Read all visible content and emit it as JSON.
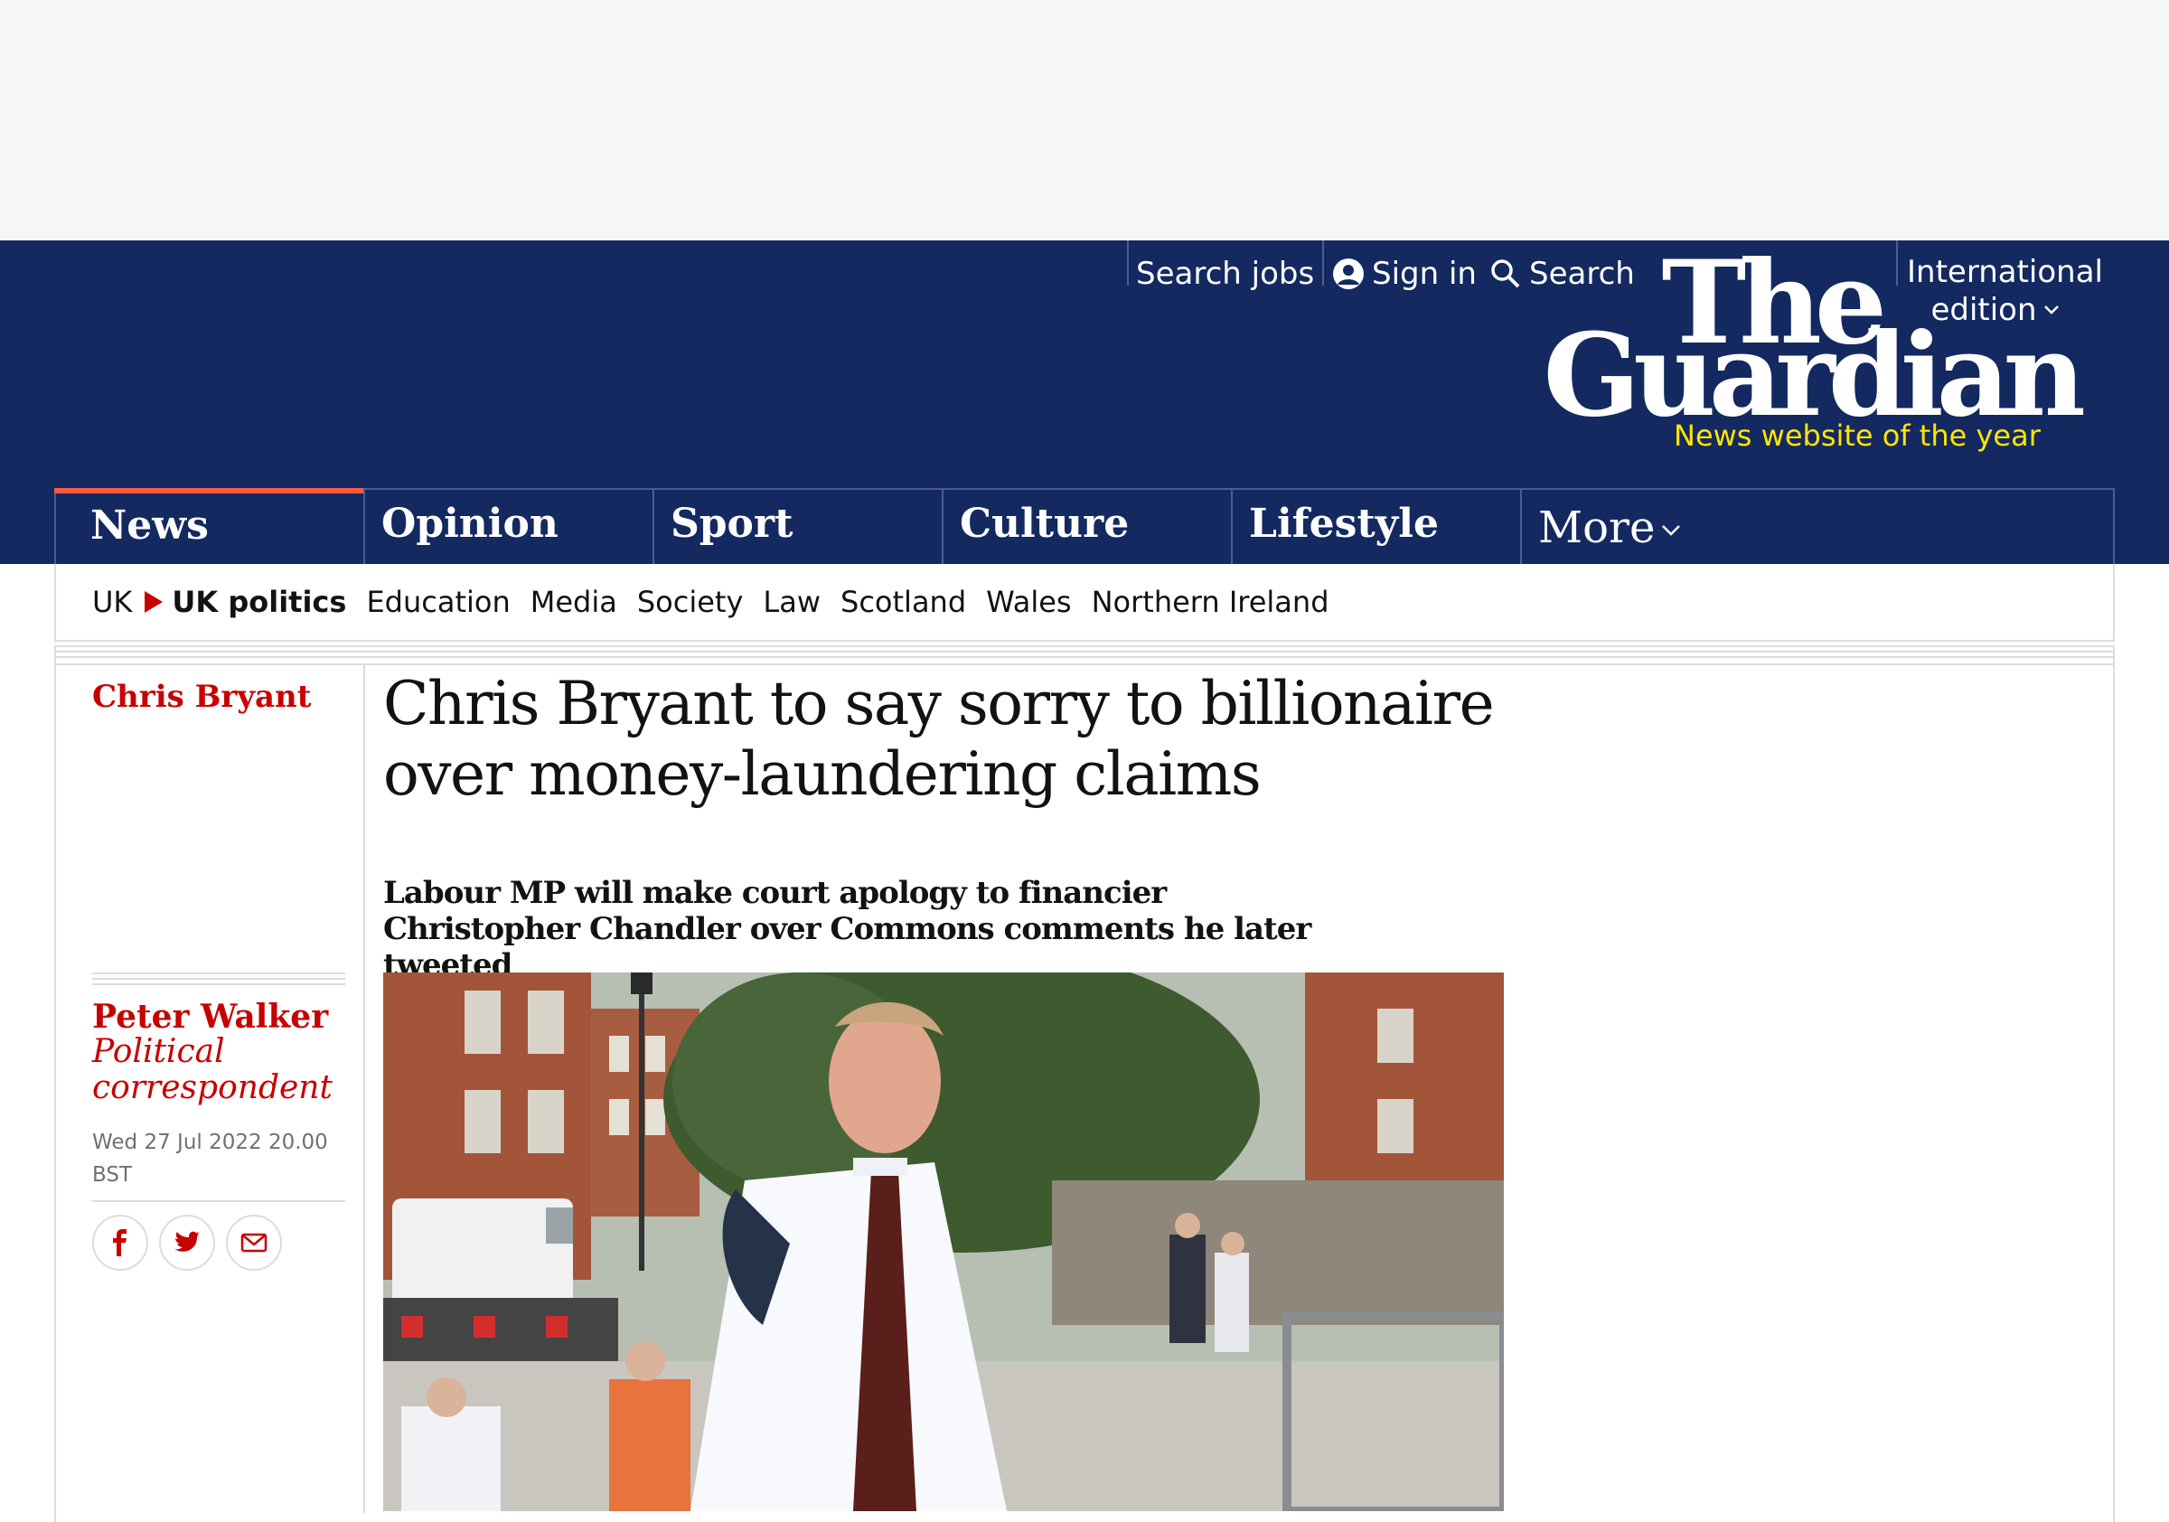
{
  "topbar": {
    "search_jobs": "Search jobs",
    "sign_in": "Sign in",
    "search": "Search",
    "edition_line1": "International",
    "edition_line2": "edition"
  },
  "logo": {
    "line1": "The",
    "line2": "Guardian",
    "tagline": "News website of the year"
  },
  "pillars": [
    {
      "label": "News",
      "active": true
    },
    {
      "label": "Opinion"
    },
    {
      "label": "Sport"
    },
    {
      "label": "Culture"
    },
    {
      "label": "Lifestyle"
    },
    {
      "label": "More"
    }
  ],
  "subnav": {
    "parent": "UK",
    "current": "UK politics",
    "items": [
      "Education",
      "Media",
      "Society",
      "Law",
      "Scotland",
      "Wales",
      "Northern Ireland"
    ]
  },
  "article": {
    "series": "Chris Bryant",
    "headline": "Chris Bryant to say sorry to billionaire over money-laundering claims",
    "standfirst": "Labour MP will make court apology to financier Christopher Chandler over Commons comments he later tweeted",
    "author": "Peter Walker",
    "role": "Political correspondent",
    "date": "Wed 27 Jul 2022 20.00 BST"
  },
  "share": {
    "icons": [
      "facebook-icon",
      "twitter-icon",
      "email-icon"
    ]
  },
  "colors": {
    "brand": "#132960",
    "news_accent": "#ff5943",
    "kicker": "#c70000",
    "tagline": "#ffe500"
  }
}
